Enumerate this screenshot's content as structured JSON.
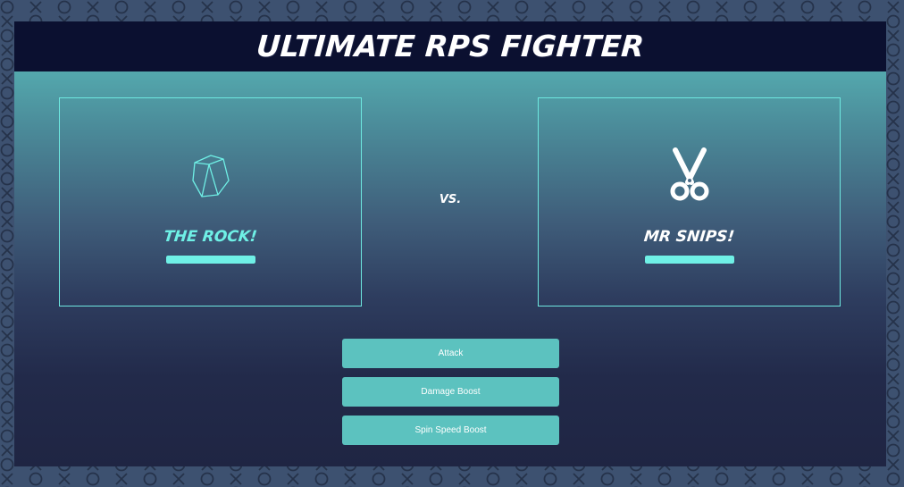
{
  "header": {
    "title": "ULTIMATE RPS FIGHTER"
  },
  "player": {
    "name": "THE ROCK!",
    "icon": "rock-icon",
    "health_fraction": 1.0,
    "name_color": "#6ff0e6"
  },
  "opponent": {
    "name": "MR SNIPS!",
    "icon": "scissors-icon",
    "health_fraction": 1.0,
    "name_color": "#ffffff"
  },
  "versus": {
    "label": "VS."
  },
  "actions": {
    "attack_label": "Attack",
    "damage_boost_label": "Damage Boost",
    "spin_speed_boost_label": "Spin Speed Boost"
  },
  "colors": {
    "accent": "#6ff0e6",
    "button": "#5cc2bf",
    "header_bg": "#0b1030",
    "background_pattern": "#3d5170"
  }
}
